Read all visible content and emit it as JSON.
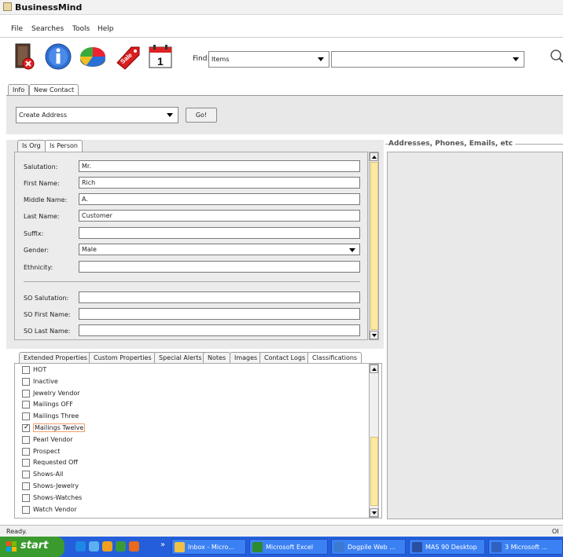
{
  "window": {
    "title": "BusinessMind"
  },
  "menu": [
    "File",
    "Searches",
    "Tools",
    "Help"
  ],
  "toolbar": {
    "icons": [
      "exit-icon",
      "info-icon",
      "pie-chart-icon",
      "sale-tag-icon",
      "calendar-icon"
    ],
    "calendar_day": "1",
    "sale_text": "Sale",
    "find_label": "Find:",
    "find_type": "Items",
    "find_value": ""
  },
  "top_tabs": [
    "Info",
    "New Contact"
  ],
  "action": {
    "selected": "Create Address",
    "go_label": "Go!"
  },
  "form_tabs": [
    "Is Org",
    "Is Person"
  ],
  "form": {
    "salutation": {
      "label": "Salutation:",
      "value": "Mr."
    },
    "first_name": {
      "label": "First Name:",
      "value": "Rich"
    },
    "middle_name": {
      "label": "Middle Name:",
      "value": "A."
    },
    "last_name": {
      "label": "Last Name:",
      "value": "Customer"
    },
    "suffix": {
      "label": "Suffix:",
      "value": ""
    },
    "gender": {
      "label": "Gender:",
      "value": "Male"
    },
    "ethnicity": {
      "label": "Ethnicity:",
      "value": ""
    },
    "so_salutation": {
      "label": "SO Salutation:",
      "value": ""
    },
    "so_first_name": {
      "label": "SO First Name:",
      "value": ""
    },
    "so_last_name": {
      "label": "SO Last Name:",
      "value": ""
    }
  },
  "right_panel": {
    "title": "Addresses, Phones, Emails, etc"
  },
  "lower_tabs": [
    "Extended Properties",
    "Custom Properties",
    "Special Alerts",
    "Notes",
    "Images",
    "Contact Logs",
    "Classifications"
  ],
  "classifications": [
    {
      "label": "HOT",
      "checked": false
    },
    {
      "label": "Inactive",
      "checked": false
    },
    {
      "label": "Jewelry Vendor",
      "checked": false
    },
    {
      "label": "Mailings OFF",
      "checked": false
    },
    {
      "label": "Mailings Three",
      "checked": false
    },
    {
      "label": "Mailings Twelve",
      "checked": true
    },
    {
      "label": "Pearl Vendor",
      "checked": false
    },
    {
      "label": "Prospect",
      "checked": false
    },
    {
      "label": "Requested Off",
      "checked": false
    },
    {
      "label": "Shows-All",
      "checked": false
    },
    {
      "label": "Shows-Jewelry",
      "checked": false
    },
    {
      "label": "Shows-Watches",
      "checked": false
    },
    {
      "label": "Watch Vendor",
      "checked": false
    }
  ],
  "status": {
    "text": "Ready.",
    "right": "OI"
  },
  "taskbar": {
    "start": "start",
    "more": "»",
    "buttons": [
      "Inbox - Micro...",
      "Microsoft Excel",
      "Dogpile Web ...",
      "MAS 90 Desktop",
      "3 Microsoft ..."
    ]
  }
}
